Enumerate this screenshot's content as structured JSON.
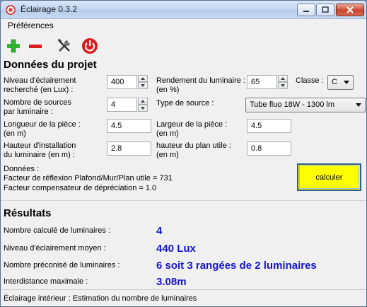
{
  "window": {
    "title": "Éclairage 0.3.2"
  },
  "menu": {
    "preferences": "Préférences"
  },
  "toolbar": {
    "add_icon": "plus-icon",
    "remove_icon": "minus-icon",
    "settings_icon": "tools-icon",
    "power_icon": "power-icon"
  },
  "project": {
    "title": "Données du projet",
    "niveau_label_1": "Niveau d'éclairement",
    "niveau_label_2": "recherché (en Lux) :",
    "niveau_value": "400",
    "rendement_label_1": "Rendement du luminaire :",
    "rendement_label_2": "(en %)",
    "rendement_value": "65",
    "classe_label": "Classe :",
    "classe_value": "C",
    "sources_label_1": "Nombre de sources",
    "sources_label_2": "par luminaire :",
    "sources_value": "4",
    "type_label": "Type de source :",
    "type_value": "Tube fluo 18W - 1300 lm",
    "longueur_label_1": "Longueur de la pièce :",
    "longueur_label_2": "(en m)",
    "longueur_value": "4.5",
    "largeur_label_1": "Largeur de la pièce :",
    "largeur_label_2": "(en m)",
    "largeur_value": "4.5",
    "hauteur_inst_label_1": "Hauteur d'installation",
    "hauteur_inst_label_2": "du luminaire (en m) :",
    "hauteur_inst_value": "2.8",
    "hauteur_plan_label_1": "hauteur du plan utile :",
    "hauteur_plan_label_2": "(en m)",
    "hauteur_plan_value": "0.8",
    "donnees_title": "Données :",
    "donnees_line_1": "Facteur de réflexion Plafond/Mur/Plan utile = 731",
    "donnees_line_2": "Facteur compensateur de dépréciation = 1.0",
    "calc_label": "calculer"
  },
  "results": {
    "title": "Résultats",
    "rows": [
      {
        "label": "Nombre calculé de luminaires :",
        "value": "4"
      },
      {
        "label": "Niveau d'éclairement moyen :",
        "value": "440 Lux"
      },
      {
        "label": "Nombre préconisé de luminaires :",
        "value": "6 soit 3 rangées de 2 luminaires"
      },
      {
        "label": "Interdistance maximale :",
        "value": "3.08m"
      }
    ]
  },
  "status": {
    "text": "Éclairage intérieur : Estimation du nombre de luminaires"
  },
  "colors": {
    "result_value": "#1515d1",
    "calc_button": "#ffff00",
    "add_icon": "#2fb52f",
    "remove_icon": "#d81e1e",
    "power_icon": "#d81e1e"
  }
}
